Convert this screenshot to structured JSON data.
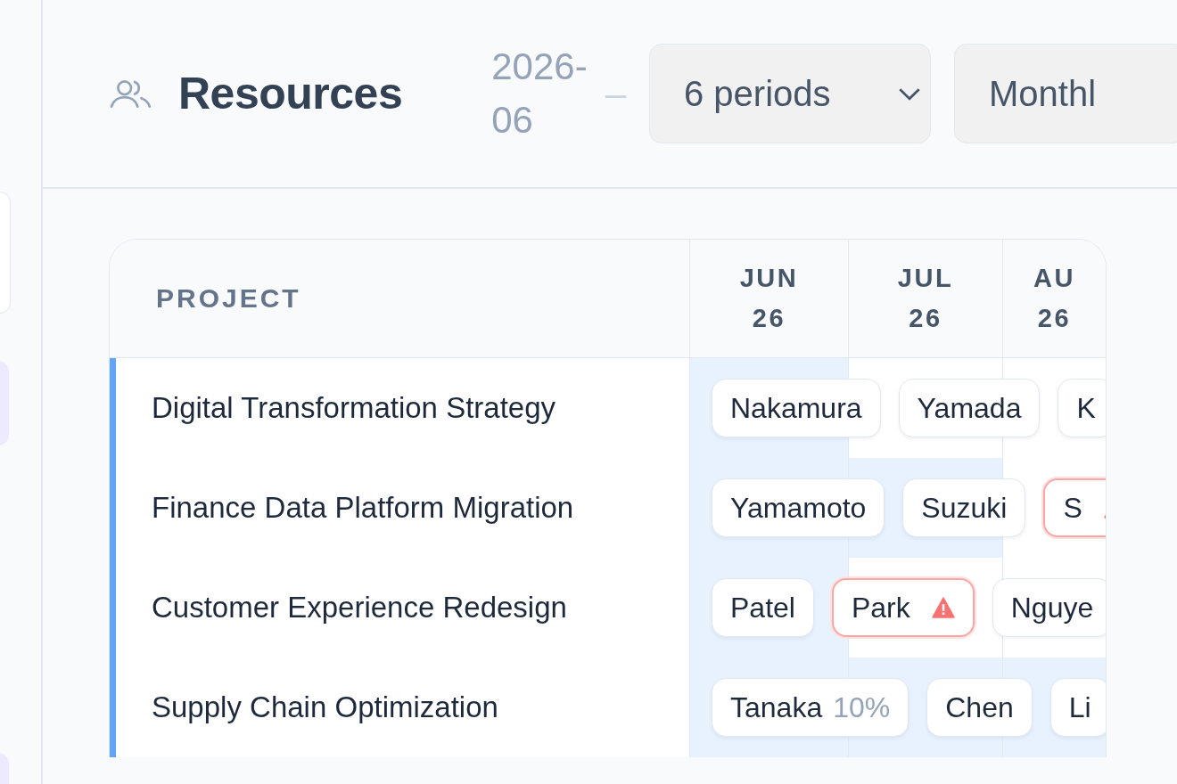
{
  "header": {
    "title": "Resources",
    "date_range_start": "2026-06",
    "range_separator": "–",
    "periods_select": "6 periods",
    "interval_select": "Monthl"
  },
  "table": {
    "project_column": "PROJECT",
    "months": [
      {
        "month": "JUN",
        "year": "26"
      },
      {
        "month": "JUL",
        "year": "26"
      },
      {
        "month": "AU",
        "year": "26"
      }
    ],
    "rows": [
      {
        "project": "Digital Transformation Strategy",
        "allocated": [
          true,
          false,
          false
        ],
        "people": [
          {
            "name": "Nakamura",
            "warning": false
          },
          {
            "name": "Yamada",
            "warning": false
          },
          {
            "name": "K",
            "warning": false
          }
        ]
      },
      {
        "project": "Finance Data Platform Migration",
        "allocated": [
          true,
          true,
          false
        ],
        "people": [
          {
            "name": "Yamamoto",
            "warning": false
          },
          {
            "name": "Suzuki",
            "warning": false
          },
          {
            "name": "S",
            "warning": true
          }
        ]
      },
      {
        "project": "Customer Experience Redesign",
        "allocated": [
          true,
          false,
          false
        ],
        "people": [
          {
            "name": "Patel",
            "warning": false
          },
          {
            "name": "Park",
            "warning": true
          },
          {
            "name": "Nguye",
            "warning": false
          }
        ]
      },
      {
        "project": "Supply Chain Optimization",
        "allocated": [
          true,
          true,
          true
        ],
        "people": [
          {
            "name": "Tanaka",
            "percent": "10%",
            "warning": false
          },
          {
            "name": "Chen",
            "warning": false
          },
          {
            "name": "Li",
            "warning": false
          }
        ]
      }
    ]
  }
}
